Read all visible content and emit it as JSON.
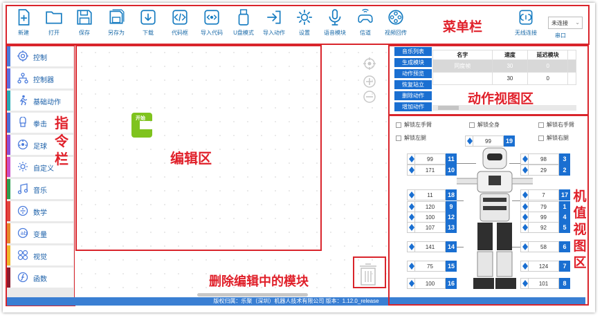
{
  "toolbar": {
    "buttons": [
      "新建",
      "打开",
      "保存",
      "另存为",
      "下载",
      "代码框",
      "导入代码",
      "U盘模式",
      "导入动作",
      "设置",
      "语音模块",
      "信道",
      "视频回传"
    ],
    "wireless": "无线连接",
    "port": {
      "value": "未连接",
      "label": "串口"
    }
  },
  "sidebar": {
    "categories": [
      "控制",
      "控制器",
      "基础动作",
      "拳击",
      "足球",
      "自定义",
      "音乐",
      "数学",
      "变量",
      "视觉",
      "函数"
    ]
  },
  "editor": {
    "start_block": "开始"
  },
  "action_panel": {
    "buttons": [
      "音乐列表",
      "生成模块",
      "动作预览",
      "恢复站立",
      "删除动作",
      "增加动作"
    ],
    "columns": [
      "名字",
      "速度",
      "延迟模块"
    ],
    "rows": [
      {
        "name": "同度帧",
        "speed": "30",
        "delay": "0"
      },
      {
        "name": "",
        "speed": "30",
        "delay": "0"
      }
    ]
  },
  "servo_panel": {
    "checks": [
      "解锁左手臂",
      "解锁全身",
      "解锁右手臂",
      "解锁左腿",
      "解锁右腿"
    ],
    "head": {
      "value": "99",
      "id": "19"
    },
    "left": [
      {
        "value": "99",
        "id": "11"
      },
      {
        "value": "171",
        "id": "10"
      },
      {
        "value": "11",
        "id": "18"
      },
      {
        "value": "120",
        "id": "9"
      },
      {
        "value": "100",
        "id": "12"
      },
      {
        "value": "107",
        "id": "13"
      },
      {
        "value": "141",
        "id": "14"
      },
      {
        "value": "75",
        "id": "15"
      },
      {
        "value": "100",
        "id": "16"
      }
    ],
    "right": [
      {
        "value": "98",
        "id": "3"
      },
      {
        "value": "29",
        "id": "2"
      },
      {
        "value": "7",
        "id": "17"
      },
      {
        "value": "79",
        "id": "1"
      },
      {
        "value": "99",
        "id": "4"
      },
      {
        "value": "92",
        "id": "5"
      },
      {
        "value": "58",
        "id": "6"
      },
      {
        "value": "124",
        "id": "7"
      },
      {
        "value": "101",
        "id": "8"
      }
    ]
  },
  "status_bar": "版权归属：乐聚（深圳）机器人技术有限公司 版本：1.12.0_release",
  "annotations": {
    "menu": "菜单栏",
    "action_view": "动作视图区",
    "editor": "编辑区",
    "delete": "删除编辑中的模块",
    "instruction": [
      "指",
      "令",
      "栏"
    ],
    "servo": [
      "机",
      "值",
      "视",
      "图",
      "区"
    ]
  },
  "colors": {
    "primary": "#1a6fd1",
    "annotation": "#e0202a",
    "start_block": "#7fc31e"
  }
}
